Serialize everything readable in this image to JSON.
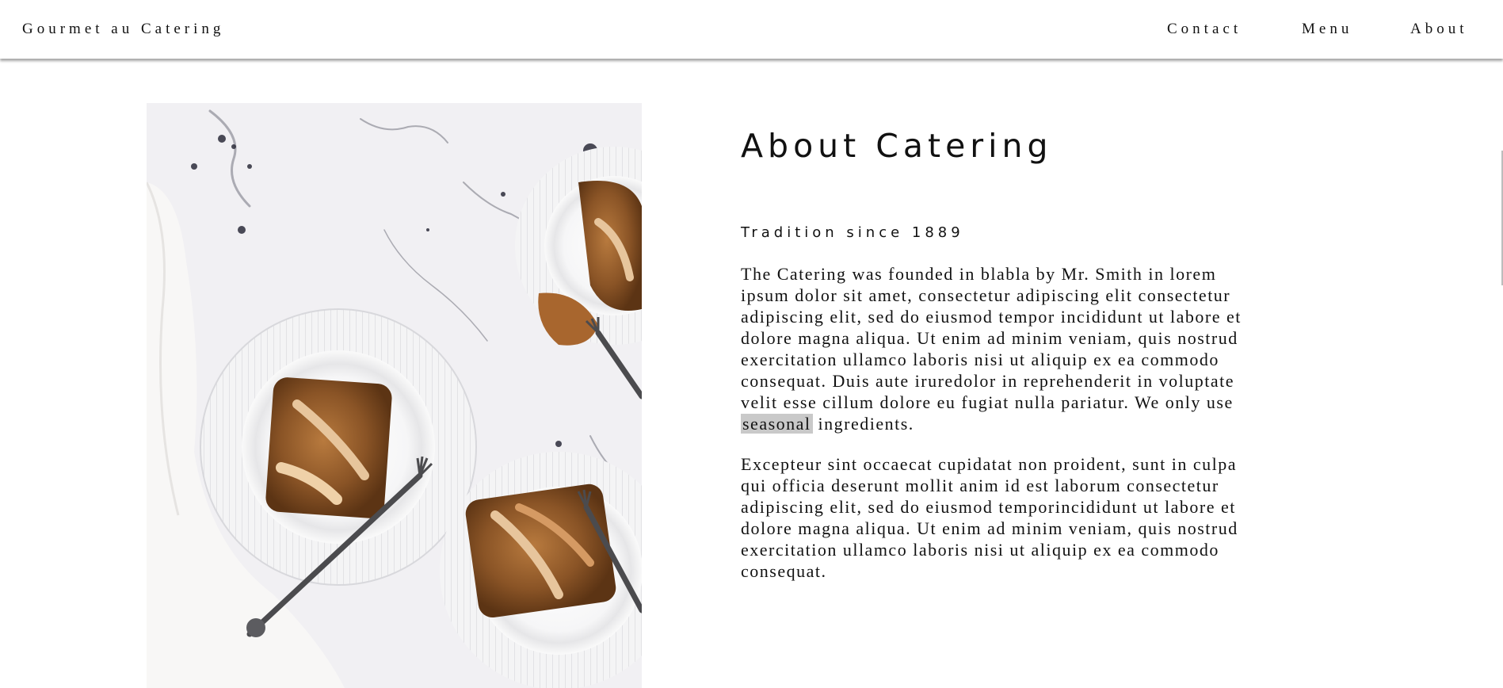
{
  "header": {
    "brand": "Gourmet au Catering",
    "nav": {
      "contact": "Contact",
      "menu": "Menu",
      "about": "About"
    }
  },
  "photo": {
    "subject": "apple tart slices on white plates with forks on marble"
  },
  "main": {
    "title": "About Catering",
    "subtitle": "Tradition since 1889",
    "paragraph1_before": "The Catering was founded in blabla by Mr. Smith in lorem ipsum dolor sit amet, consectetur adipiscing elit consectetur adipiscing elit, sed do eiusmod tempor incididunt ut labore et dolore magna aliqua. Ut enim ad minim veniam, quis nostrud exercitation ullamco laboris nisi ut aliquip ex ea commodo consequat. Duis aute iruredolor in reprehenderit in voluptate velit esse cillum dolore eu fugiat nulla pariatur. We only use",
    "paragraph1_highlight": "seasonal",
    "paragraph1_after": "ingredients.",
    "paragraph2": "Excepteur sint occaecat cupidatat non proident, sunt in culpa qui officia deserunt mollit anim id est laborum consectetur adipiscing elit, sed do eiusmod temporincididunt ut labore et dolore magna aliqua. Ut enim ad minim veniam, quis nostrud exercitation ullamco laboris nisi ut aliquip ex ea commodo consequat."
  },
  "colors": {
    "background": "#ffffff",
    "text": "#111111",
    "highlight": "#c9c9c9"
  }
}
